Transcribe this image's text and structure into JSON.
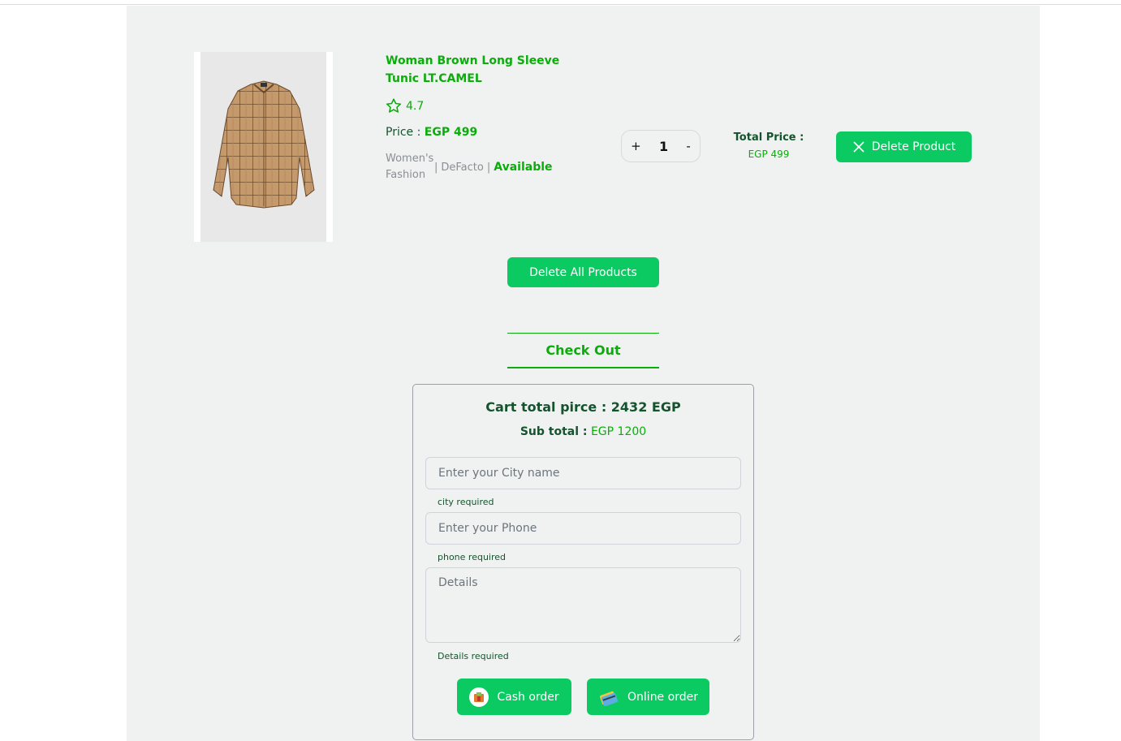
{
  "product": {
    "title_line1": "Woman Brown Long Sleeve",
    "title_line2": "Tunic LT.CAMEL",
    "rating": "4.7",
    "price_label": "Price :",
    "price_value": "EGP 499",
    "category_line1": "Women's",
    "category_line2": "Fashion",
    "separator": "|",
    "brand": "DeFacto",
    "availability": "Available",
    "quantity": "1",
    "increment_symbol": "+",
    "decrement_symbol": "-",
    "total_label": "Total Price :",
    "total_value": "EGP 499",
    "delete_label": "Delete Product",
    "image_icon": "plaid-shirt-image"
  },
  "cart": {
    "delete_all_label": "Delete All Products"
  },
  "checkout": {
    "tab_label": "Check Out",
    "cart_total": "Cart total pirce : 2432 EGP",
    "subtotal_label": "Sub total :",
    "subtotal_value": "EGP 1200",
    "city_placeholder": "Enter your City name",
    "city_error": "city required",
    "phone_placeholder": "Enter your Phone",
    "phone_error": "phone required",
    "details_placeholder": "Details",
    "details_error": "Details required",
    "cash_label": "Cash order",
    "online_label": "Online order"
  },
  "colors": {
    "accent": "#0aad0a",
    "button": "#0cca62",
    "panel": "#f0f2f1",
    "dark_green": "#14532d"
  }
}
